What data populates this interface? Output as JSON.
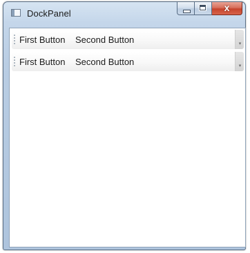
{
  "window": {
    "title": "DockPanel",
    "icon": "window-app-icon"
  },
  "caption": {
    "minimize_icon": "minimize-icon",
    "maximize_icon": "maximize-icon",
    "close_icon": "close-icon",
    "close_glyph": "x"
  },
  "toolbars": [
    {
      "first_button_label": "First Button",
      "second_button_label": "Second Button",
      "overflow_icon": "overflow-chevron-icon"
    },
    {
      "first_button_label": "First Button",
      "second_button_label": "Second Button",
      "overflow_icon": "overflow-chevron-icon"
    }
  ],
  "colors": {
    "frame": "#b9cde3",
    "close_button": "#c7442c",
    "client_background": "#ffffff"
  }
}
